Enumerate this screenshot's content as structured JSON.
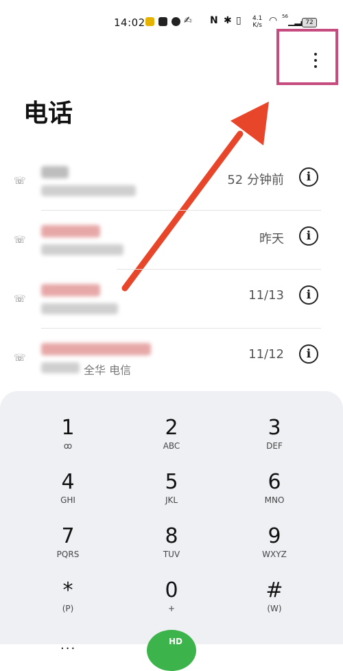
{
  "status": {
    "time": "14:02",
    "speed": "4.1",
    "speed_unit": "K/s",
    "signal": "56",
    "battery": "72"
  },
  "header": {
    "title": "电话",
    "more_label": "⋮"
  },
  "calls": [
    {
      "time": "52 分钟前",
      "carrier": ""
    },
    {
      "time": "昨天",
      "carrier": ""
    },
    {
      "time": "11/13",
      "carrier": ""
    },
    {
      "time": "11/12",
      "carrier": "全华 电信"
    }
  ],
  "dialpad": {
    "keys": [
      {
        "digit": "1",
        "letters": "ꝏ"
      },
      {
        "digit": "2",
        "letters": "ABC"
      },
      {
        "digit": "3",
        "letters": "DEF"
      },
      {
        "digit": "4",
        "letters": "GHI"
      },
      {
        "digit": "5",
        "letters": "JKL"
      },
      {
        "digit": "6",
        "letters": "MNO"
      },
      {
        "digit": "7",
        "letters": "PQRS"
      },
      {
        "digit": "8",
        "letters": "TUV"
      },
      {
        "digit": "9",
        "letters": "WXYZ"
      },
      {
        "digit": "*",
        "letters": "(P)"
      },
      {
        "digit": "0",
        "letters": "+"
      },
      {
        "digit": "#",
        "letters": "(W)"
      }
    ],
    "hd_label": "HD",
    "menu_label": "..."
  },
  "colors": {
    "highlight": "#c64b7e",
    "arrow": "#e8462a",
    "call_button": "#3cb44b",
    "pad_bg": "#eef0f4"
  }
}
